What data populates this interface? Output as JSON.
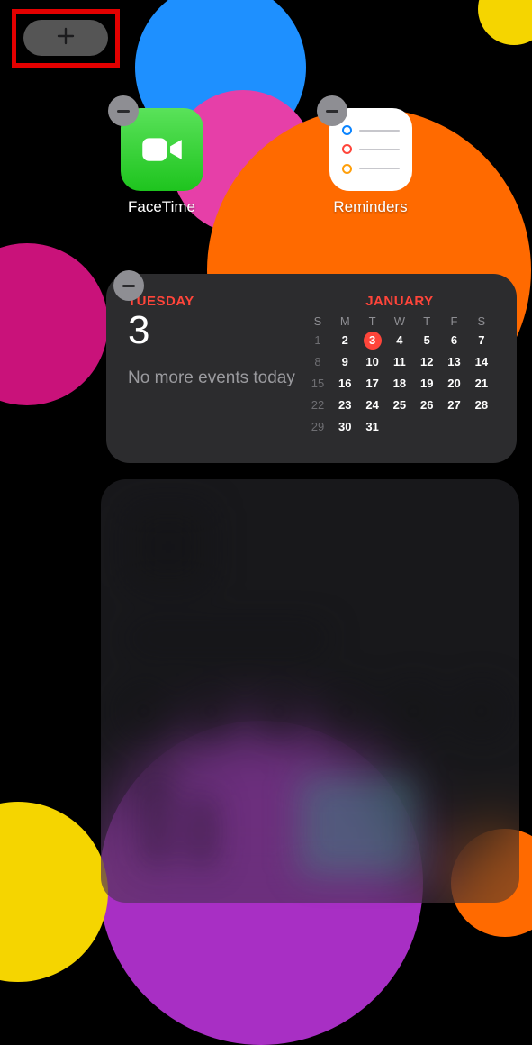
{
  "add_button": {
    "icon_name": "plus-icon"
  },
  "apps": [
    {
      "label": "FaceTime",
      "icon": "facetime"
    },
    {
      "label": "Reminders",
      "icon": "reminders"
    }
  ],
  "calendar_widget": {
    "day_name": "TUESDAY",
    "day_number": "3",
    "events_text": "No more events today",
    "month": "JANUARY",
    "dow": [
      "S",
      "M",
      "T",
      "W",
      "T",
      "F",
      "S"
    ],
    "weeks": [
      [
        {
          "n": "1",
          "dim": true
        },
        {
          "n": "2"
        },
        {
          "n": "3",
          "today": true
        },
        {
          "n": "4"
        },
        {
          "n": "5"
        },
        {
          "n": "6"
        },
        {
          "n": "7"
        }
      ],
      [
        {
          "n": "8",
          "dim": true
        },
        {
          "n": "9"
        },
        {
          "n": "10"
        },
        {
          "n": "11"
        },
        {
          "n": "12"
        },
        {
          "n": "13"
        },
        {
          "n": "14"
        }
      ],
      [
        {
          "n": "15",
          "dim": true
        },
        {
          "n": "16"
        },
        {
          "n": "17"
        },
        {
          "n": "18"
        },
        {
          "n": "19"
        },
        {
          "n": "20"
        },
        {
          "n": "21"
        }
      ],
      [
        {
          "n": "22",
          "dim": true
        },
        {
          "n": "23"
        },
        {
          "n": "24"
        },
        {
          "n": "25"
        },
        {
          "n": "26"
        },
        {
          "n": "27"
        },
        {
          "n": "28"
        }
      ],
      [
        {
          "n": "29",
          "dim": true
        },
        {
          "n": "30"
        },
        {
          "n": "31"
        },
        {
          "n": ""
        },
        {
          "n": ""
        },
        {
          "n": ""
        },
        {
          "n": ""
        }
      ]
    ]
  },
  "reminders_colors": [
    "#0a84ff",
    "#ff453a",
    "#ff9f0a"
  ]
}
